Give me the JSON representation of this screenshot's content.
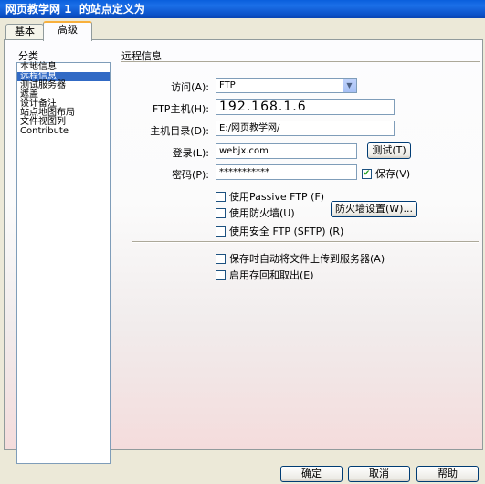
{
  "window": {
    "title": "网页教学网 1  的站点定义为"
  },
  "tabs": [
    {
      "label": "基本"
    },
    {
      "label": "高级"
    }
  ],
  "category": {
    "label": "分类",
    "items": [
      "本地信息",
      "远程信息",
      "测试服务器",
      "遮盖",
      "设计备注",
      "站点地图布局",
      "文件视图列",
      "Contribute"
    ],
    "selected": "远程信息"
  },
  "remote": {
    "section_title": "远程信息",
    "access_label": "访问(A):",
    "access_value": "FTP",
    "host_label": "FTP主机(H):",
    "host_value": "192.168.1.6",
    "dir_label": "主机目录(D):",
    "dir_value": "E:/网页教学网/",
    "login_label": "登录(L):",
    "login_value": "webjx.com",
    "test_button": "测试(T)",
    "password_label": "密码(P):",
    "password_value": "***********",
    "save_label": "保存(V)",
    "save_checked": true,
    "passive_label": "使用Passive FTP (F)",
    "passive_checked": false,
    "firewall_label": "使用防火墙(U)",
    "firewall_checked": false,
    "firewall_settings_button": "防火墙设置(W)...",
    "sftp_label": "使用安全 FTP (SFTP)  (R)",
    "sftp_checked": false,
    "autoupload_label": "保存时自动将文件上传到服务器(A)",
    "autoupload_checked": false,
    "checkout_label": "启用存回和取出(E)",
    "checkout_checked": false
  },
  "footer": {
    "ok": "确定",
    "cancel": "取消",
    "help": "帮助"
  }
}
